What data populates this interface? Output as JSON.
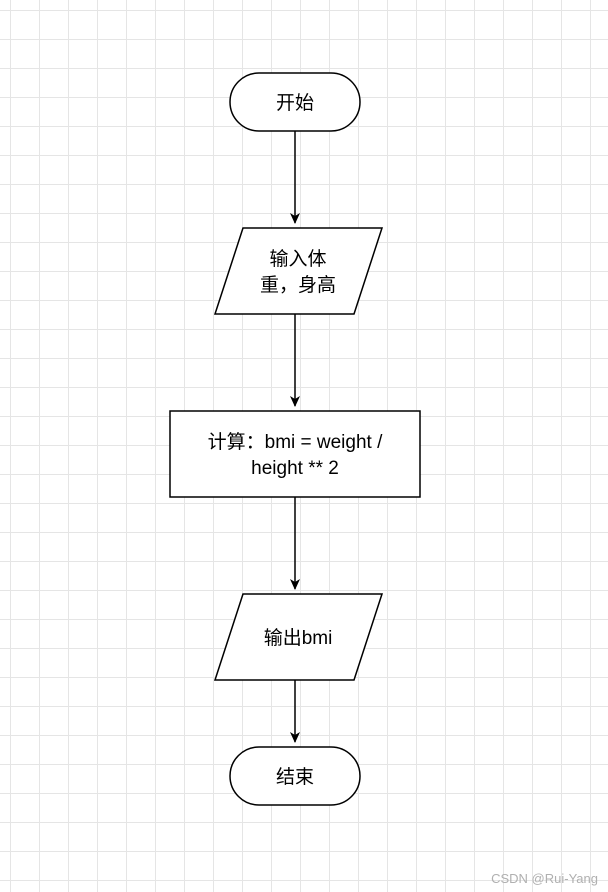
{
  "flowchart": {
    "start": "开始",
    "input_line1": "输入体",
    "input_line2": "重，身高",
    "process_line1": "计算：bmi = weight /",
    "process_line2": "height ** 2",
    "output": "输出bmi",
    "end": "结束"
  },
  "watermark": "CSDN @Rui-Yang"
}
